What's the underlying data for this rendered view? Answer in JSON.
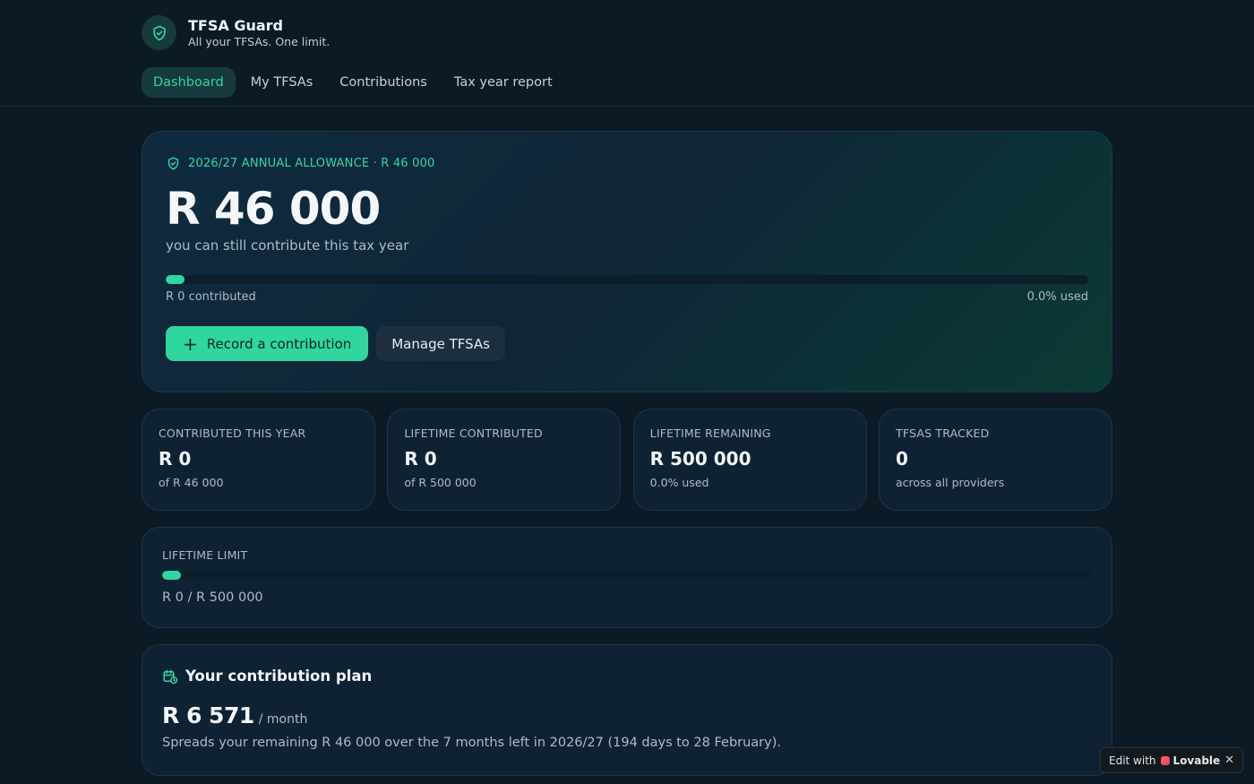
{
  "app": {
    "title": "TFSA Guard",
    "subtitle": "All your TFSAs. One limit.",
    "logo_icon": "shield-check-icon"
  },
  "nav": [
    {
      "label": "Dashboard",
      "active": true
    },
    {
      "label": "My TFSAs",
      "active": false
    },
    {
      "label": "Contributions",
      "active": false
    },
    {
      "label": "Tax year report",
      "active": false
    }
  ],
  "hero": {
    "badge": "2026/27 ANNUAL ALLOWANCE · R 46 000",
    "badge_icon": "shield-check-icon",
    "amount": "R 46 000",
    "subtitle": "you can still contribute this tax year",
    "progress_fraction": 0.0,
    "contributed_label": "R 0 contributed",
    "used_label": "0.0% used",
    "primary_button": "Record a contribution",
    "primary_icon": "plus-icon",
    "secondary_button": "Manage TFSAs"
  },
  "stats": [
    {
      "label": "CONTRIBUTED THIS YEAR",
      "value": "R 0",
      "sub": "of R 46 000"
    },
    {
      "label": "LIFETIME CONTRIBUTED",
      "value": "R 0",
      "sub": "of R 500 000"
    },
    {
      "label": "LIFETIME REMAINING",
      "value": "R 500 000",
      "sub": "0.0% used"
    },
    {
      "label": "TFSAS TRACKED",
      "value": "0",
      "sub": "across all providers"
    }
  ],
  "lifetime": {
    "label": "LIFETIME LIMIT",
    "progress_fraction": 0.0,
    "text": "R 0 / R 500 000"
  },
  "plan": {
    "title": "Your contribution plan",
    "icon": "calendar-clock-icon",
    "amount": "R 6 571",
    "unit": "/ month",
    "description": "Spreads your remaining R 46 000 over the 7 months left in 2026/27 (194 days to 28 February)."
  },
  "badge_widget": {
    "prefix": "Edit with",
    "brand": "Lovable",
    "close": "✕"
  },
  "colors": {
    "accent": "#2fd79f",
    "background": "#0c1a26",
    "card": "#0f2233"
  }
}
